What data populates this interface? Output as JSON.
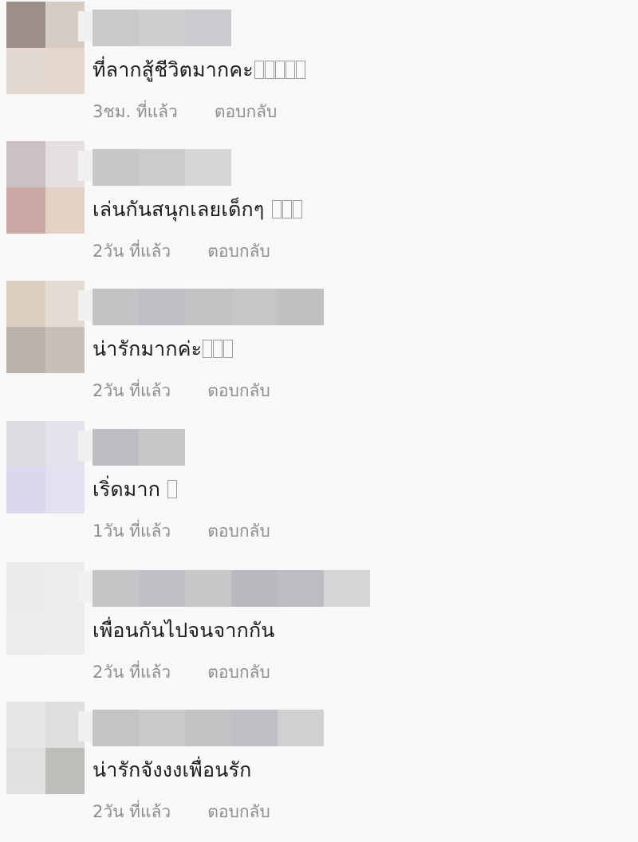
{
  "comments": [
    {
      "text": "ที่ลากสู้ชีวิตมากคะ",
      "tofu_count": 5,
      "time": "3ชม. ที่แล้ว",
      "reply_label": "ตอบกลับ",
      "avatar_colors": [
        "#9b8f88",
        "#d6ccc4",
        "#e3d9d2",
        "#e4d7cc"
      ],
      "name_blur_colors": [
        "#c9c9cc",
        "#cfcfd2",
        "#cacacf"
      ]
    },
    {
      "text": "เล่นกันสนุกเลยเด็กๆ ",
      "tofu_count": 3,
      "time": "2วัน ที่แล้ว",
      "reply_label": "ตอบกลับ",
      "avatar_colors": [
        "#cdbfc6",
        "#e4e0e0",
        "#c9a8a6",
        "#e4d2c7"
      ],
      "name_blur_colors": [
        "#c7c7ca",
        "#cbcbce",
        "#d6d6d9"
      ]
    },
    {
      "text": "น่ารักมากค่ะ",
      "tofu_count": 3,
      "time": "2วัน ที่แล้ว",
      "reply_label": "ตอบกลับ",
      "avatar_colors": [
        "#dccfc1",
        "#e4dbd2",
        "#bdb3ad",
        "#c7bfba"
      ],
      "name_blur_colors": [
        "#c3c3c6",
        "#bfbfc3",
        "#c2c2c5",
        "#c6c6c9",
        "#c1c1c4"
      ]
    },
    {
      "text": "เริ่ดมาก ",
      "tofu_count": 1,
      "time": "1วัน ที่แล้ว",
      "reply_label": "ตอบกลับ",
      "avatar_colors": [
        "#dedbe3",
        "#e4e3ec",
        "#dbd7ee",
        "#e2e1ef"
      ],
      "name_blur_colors": [
        "#bebec2",
        "#c8c8cb"
      ]
    },
    {
      "text": "เพื่อนกันไปจนจากกัน",
      "tofu_count": 0,
      "time": "2วัน ที่แล้ว",
      "reply_label": "ตอบกลับ",
      "avatar_colors": [
        "#ebebeb",
        "#ececee",
        "#ececec",
        "#ededed"
      ],
      "name_blur_colors": [
        "#c5c5c8",
        "#c1c1c5",
        "#c8c8cb",
        "#b9b9bf",
        "#bcbcc1",
        "#d5d5d8"
      ]
    },
    {
      "text": "น่ารักจังงงเพื่อนรัก",
      "tofu_count": 0,
      "time": "2วัน ที่แล้ว",
      "reply_label": "ตอบกลับ",
      "avatar_colors": [
        "#e4e6e4",
        "#dfdedd",
        "#dfe0df",
        "#bfbdb9"
      ],
      "name_blur_colors": [
        "#c4c4c7",
        "#c9c9cc",
        "#c3c3c6",
        "#bfbfc4",
        "#d0d0d3"
      ]
    }
  ]
}
